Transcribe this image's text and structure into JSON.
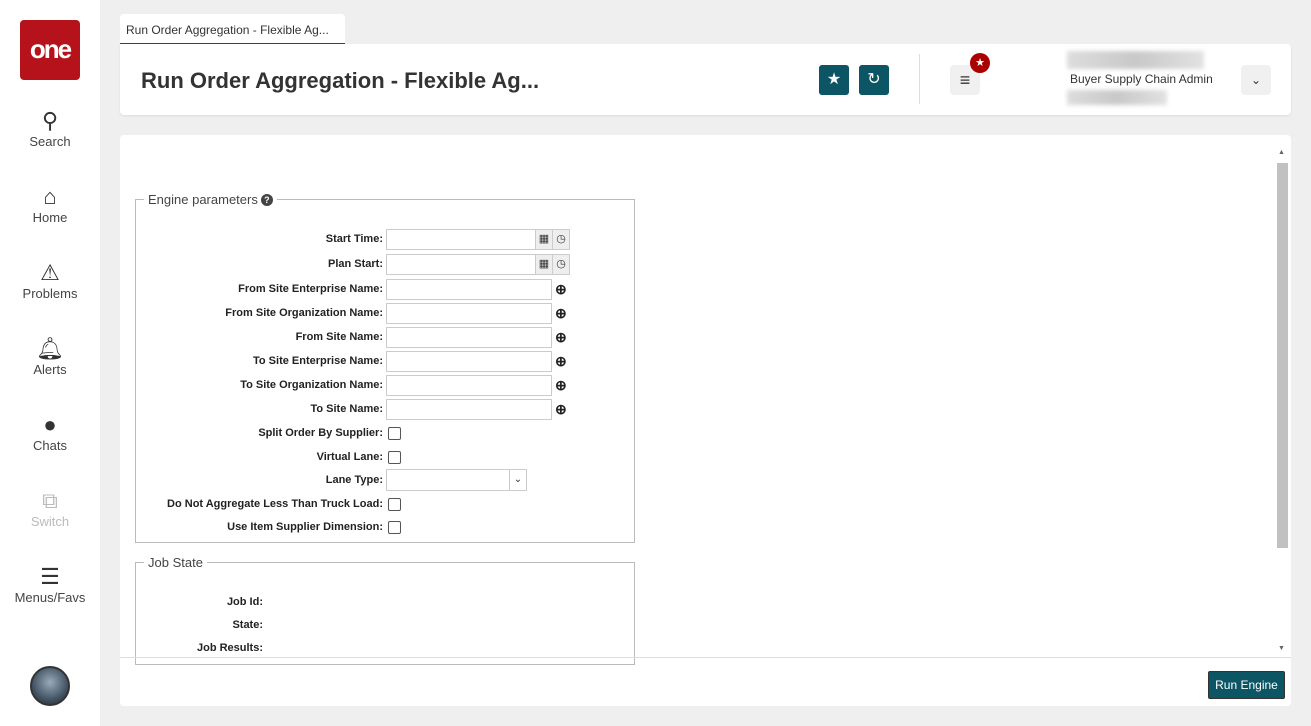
{
  "sidebar": {
    "logo": "one",
    "items": [
      {
        "label": "Search",
        "icon": "search-icon"
      },
      {
        "label": "Home",
        "icon": "home-icon"
      },
      {
        "label": "Problems",
        "icon": "warning-icon"
      },
      {
        "label": "Alerts",
        "icon": "bell-icon"
      },
      {
        "label": "Chats",
        "icon": "chat-icon"
      },
      {
        "label": "Switch",
        "icon": "switch-icon"
      },
      {
        "label": "Menus/Favs",
        "icon": "menu-icon"
      }
    ]
  },
  "tab": {
    "label": "Run Order Aggregation - Flexible Ag..."
  },
  "header": {
    "title": "Run Order Aggregation - Flexible Ag...",
    "user_role": "Buyer Supply Chain Admin"
  },
  "engine": {
    "legend": "Engine parameters",
    "fields": {
      "start_time": "Start Time:",
      "plan_start": "Plan Start:",
      "from_ent": "From Site Enterprise Name:",
      "from_org": "From Site Organization Name:",
      "from_site": "From Site Name:",
      "to_ent": "To Site Enterprise Name:",
      "to_org": "To Site Organization Name:",
      "to_site": "To Site Name:",
      "split": "Split Order By Supplier:",
      "virtual": "Virtual Lane:",
      "lane_type": "Lane Type:",
      "no_agg": "Do Not Aggregate Less Than Truck Load:",
      "item_sup": "Use Item Supplier Dimension:"
    }
  },
  "job": {
    "legend": "Job State",
    "job_id": "Job Id:",
    "state": "State:",
    "results": "Job Results:"
  },
  "footer": {
    "run_label": "Run Engine"
  }
}
